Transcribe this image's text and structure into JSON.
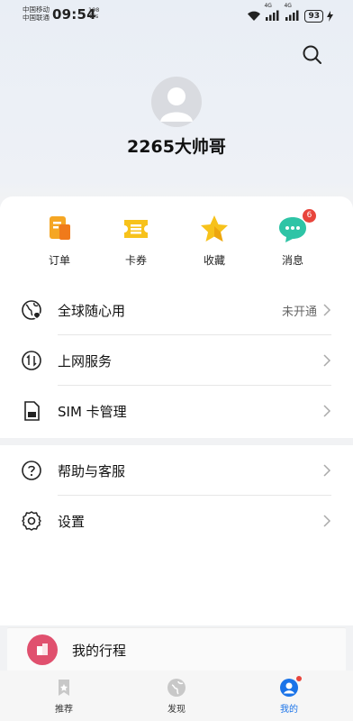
{
  "status_bar": {
    "carrier_1": "中国移动",
    "carrier_2": "中国联通",
    "time": "09:54",
    "net_speed_value": "198",
    "net_speed_unit": "B/s",
    "network_1": "4G",
    "network_2": "4G",
    "battery": "93"
  },
  "profile": {
    "username": "2265大帅哥"
  },
  "quick_actions": [
    {
      "label": "订单",
      "icon": "order-icon"
    },
    {
      "label": "卡券",
      "icon": "coupon-icon"
    },
    {
      "label": "收藏",
      "icon": "star-icon"
    },
    {
      "label": "消息",
      "icon": "message-icon",
      "badge": "6"
    }
  ],
  "menu": [
    {
      "label": "全球随心用",
      "value": "未开通",
      "icon": "globe-icon"
    },
    {
      "label": "上网服务",
      "icon": "data-service-icon"
    },
    {
      "label": "SIM 卡管理",
      "icon": "sim-card-icon"
    },
    {
      "label": "帮助与客服",
      "icon": "help-icon"
    },
    {
      "label": "设置",
      "icon": "settings-icon"
    }
  ],
  "trip": {
    "label": "我的行程"
  },
  "tabs": [
    {
      "label": "推荐",
      "icon": "bookmark-icon",
      "active": false
    },
    {
      "label": "发现",
      "icon": "discover-icon",
      "active": false
    },
    {
      "label": "我的",
      "icon": "profile-icon",
      "active": true
    }
  ],
  "colors": {
    "accent": "#1a73e8",
    "badge": "#e8453c",
    "order": "#f5a623",
    "coupon": "#f7c21b",
    "star": "#f7c21b",
    "message": "#2ec4a6",
    "trip": "#e0506e"
  }
}
